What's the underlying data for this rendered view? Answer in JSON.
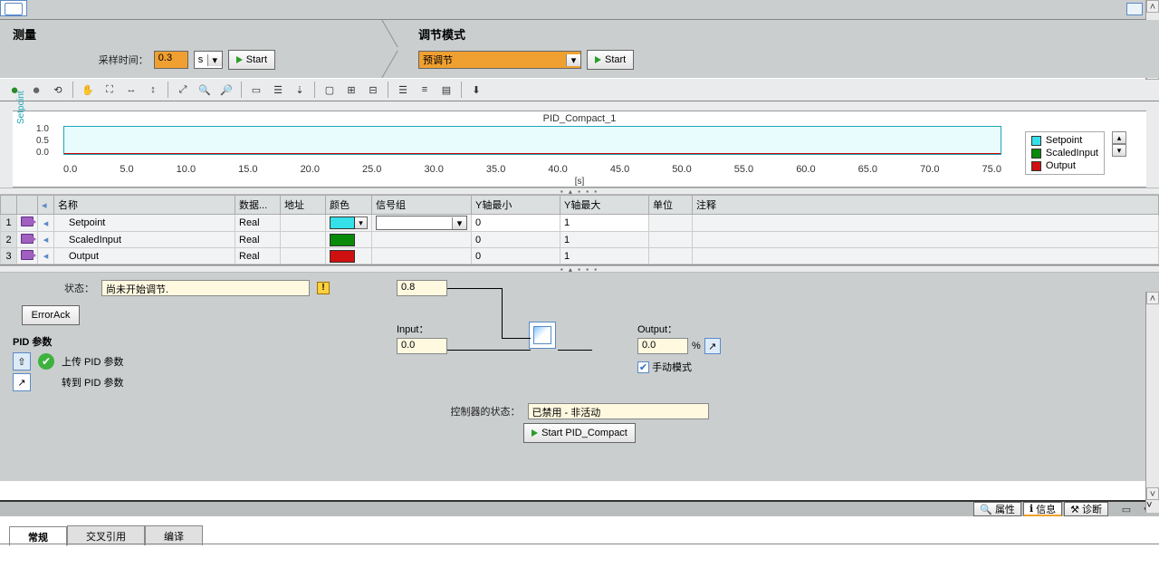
{
  "topbar": {},
  "phase1": {
    "title": "测量",
    "sample_label": "采样时间：",
    "sample_value": "0.3",
    "sample_unit": "s",
    "start": "Start"
  },
  "phase2": {
    "title": "调节模式",
    "mode": "预调节",
    "start": "Start"
  },
  "chart": {
    "title": "PID_Compact_1",
    "ylabel": "Setpoint",
    "yticks": [
      "1.0",
      "0.5",
      "0.0"
    ],
    "xticks": [
      "0.0",
      "5.0",
      "10.0",
      "15.0",
      "20.0",
      "25.0",
      "30.0",
      "35.0",
      "40.0",
      "45.0",
      "50.0",
      "55.0",
      "60.0",
      "65.0",
      "70.0",
      "75.0"
    ],
    "xunit": "[s]",
    "legend": [
      "Setpoint",
      "ScaledInput",
      "Output"
    ],
    "colors": {
      "Setpoint": "#35e0e8",
      "ScaledInput": "#0a8a0a",
      "Output": "#d01010"
    }
  },
  "chart_data": {
    "type": "line",
    "title": "PID_Compact_1",
    "xlabel": "[s]",
    "ylabel": "Setpoint",
    "xlim": [
      0,
      80
    ],
    "ylim": [
      0,
      1
    ],
    "series": [
      {
        "name": "Setpoint",
        "color": "#35e0e8",
        "values": []
      },
      {
        "name": "ScaledInput",
        "color": "#0a8a0a",
        "values": []
      },
      {
        "name": "Output",
        "color": "#d01010",
        "values": []
      }
    ],
    "x": []
  },
  "grid": {
    "cols": [
      "",
      "",
      "",
      "名称",
      "数据...",
      "地址",
      "颜色",
      "信号组",
      "Y轴最小",
      "Y轴最大",
      "单位",
      "注释"
    ],
    "rows": [
      {
        "n": "1",
        "name": "Setpoint",
        "type": "Real",
        "color": "#35e0e8",
        "ymin": "0",
        "ymax": "1"
      },
      {
        "n": "2",
        "name": "ScaledInput",
        "type": "Real",
        "color": "#0a8a0a",
        "ymin": "0",
        "ymax": "1"
      },
      {
        "n": "3",
        "name": "Output",
        "type": "Real",
        "color": "#d01010",
        "ymin": "0",
        "ymax": "1"
      }
    ]
  },
  "status": {
    "label": "状态：",
    "value": "尚未开始调节."
  },
  "errorack": "ErrorAck",
  "pid": {
    "heading": "PID 参数",
    "upload": "上传 PID 参数",
    "goto": "转到 PID 参数"
  },
  "dg": {
    "sp": "0.8",
    "input_lbl": "Input：",
    "input": "0.0",
    "output_lbl": "Output：",
    "output": "0.0",
    "output_unit": "%",
    "manual": "手动模式"
  },
  "ctrl": {
    "label": "控制器的状态：",
    "value": "已禁用 - 非活动",
    "btn": "Start PID_Compact"
  },
  "tabs": {
    "prop": "属性",
    "info": "信息",
    "diag": "诊断"
  },
  "bottom": {
    "general": "常规",
    "xref": "交叉引用",
    "compile": "编译"
  }
}
